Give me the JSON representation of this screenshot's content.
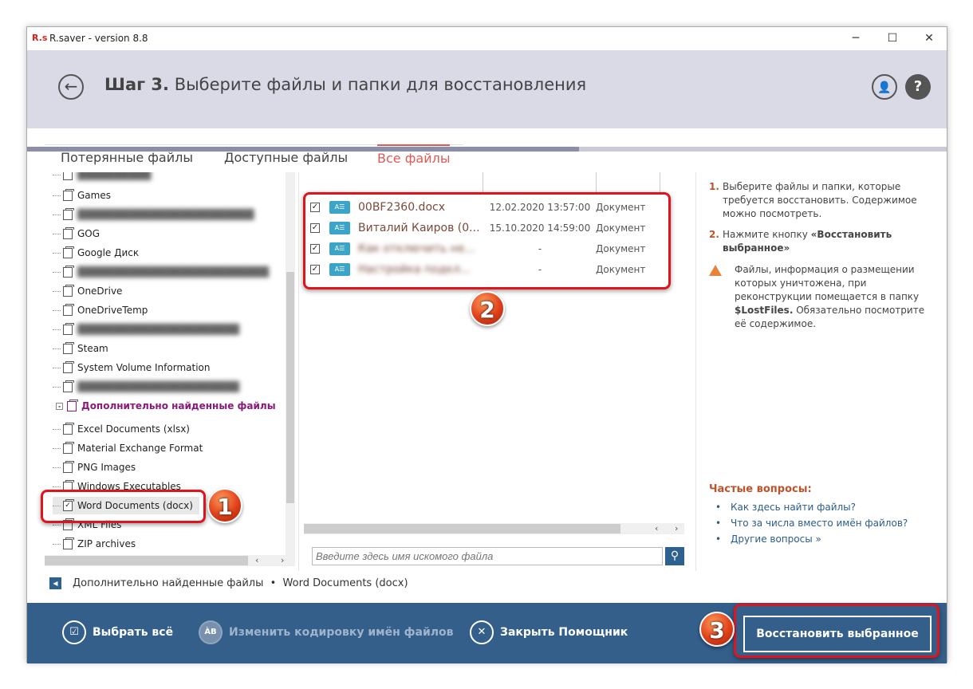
{
  "window": {
    "title": "R.saver - version 8.8",
    "logo": "R.s",
    "minimize": "─",
    "maximize": "☐",
    "close": "✕"
  },
  "header": {
    "step": "Шаг 3.",
    "title": "Выберите файлы и папки для восстановления",
    "progress_percent": 60
  },
  "tabs": [
    {
      "label": "Потерянные файлы",
      "active": false
    },
    {
      "label": "Доступные файлы",
      "active": false
    },
    {
      "label": "Все файлы",
      "active": true
    }
  ],
  "tree": {
    "items": [
      "Games",
      "GOG",
      "Google Диск",
      "OneDrive",
      "OneDriveTemp",
      "Steam",
      "System Volume Information"
    ],
    "extra_section": "Дополнительно найденные файлы",
    "extra_items": [
      "Excel Documents (xlsx)",
      "Material Exchange Format",
      "PNG Images",
      "Windows Executables",
      "Word Documents (docx)",
      "XML Files",
      "ZIP archives"
    ]
  },
  "files": [
    {
      "name": "00BF2360.docx",
      "date": "12.02.2020 13:57:00",
      "type": "Документ",
      "checked": true
    },
    {
      "name": "Виталий Каиров (0...",
      "date": "15.10.2020 14:59:00",
      "type": "Документ",
      "checked": true
    },
    {
      "name": "Как отключить не...",
      "date": "-",
      "type": "Документ",
      "checked": true
    },
    {
      "name": "Настройка подкл...",
      "date": "-",
      "type": "Документ",
      "checked": true
    }
  ],
  "search": {
    "placeholder": "Введите здесь имя искомого файла"
  },
  "help": {
    "step1_num": "1.",
    "step1": "Выберите файлы и папки, которые требуется восстановить. Содержимое можно посмотреть.",
    "step2_num": "2.",
    "step2_pre": "Нажмите кнопку ",
    "step2_bold": "«Восстановить выбранное»",
    "warn_pre": "Файлы, информация о размещении которых уничтожена, при реконструкции помещается в папку ",
    "warn_bold": "$LostFiles.",
    "warn_post": " Обязательно посмотрите её содержимое."
  },
  "faq": {
    "title": "Частые вопросы:",
    "items": [
      "Как здесь найти файлы?",
      "Что за числа вместо имён файлов?",
      "Другие вопросы »"
    ]
  },
  "breadcrumb": {
    "path": "Дополнительно найденные файлы  •  Word Documents (docx)"
  },
  "bottom": {
    "select_all": "Выбрать всё",
    "encoding": "Изменить кодировку имён файлов",
    "close_wizard": "Закрыть Помощник",
    "restore": "Восстановить выбранное"
  },
  "annotations": [
    "1",
    "2",
    "3"
  ],
  "colors": {
    "accent": "#335f8a",
    "active_tab": "#e05a55",
    "highlight": "#e0141c"
  }
}
